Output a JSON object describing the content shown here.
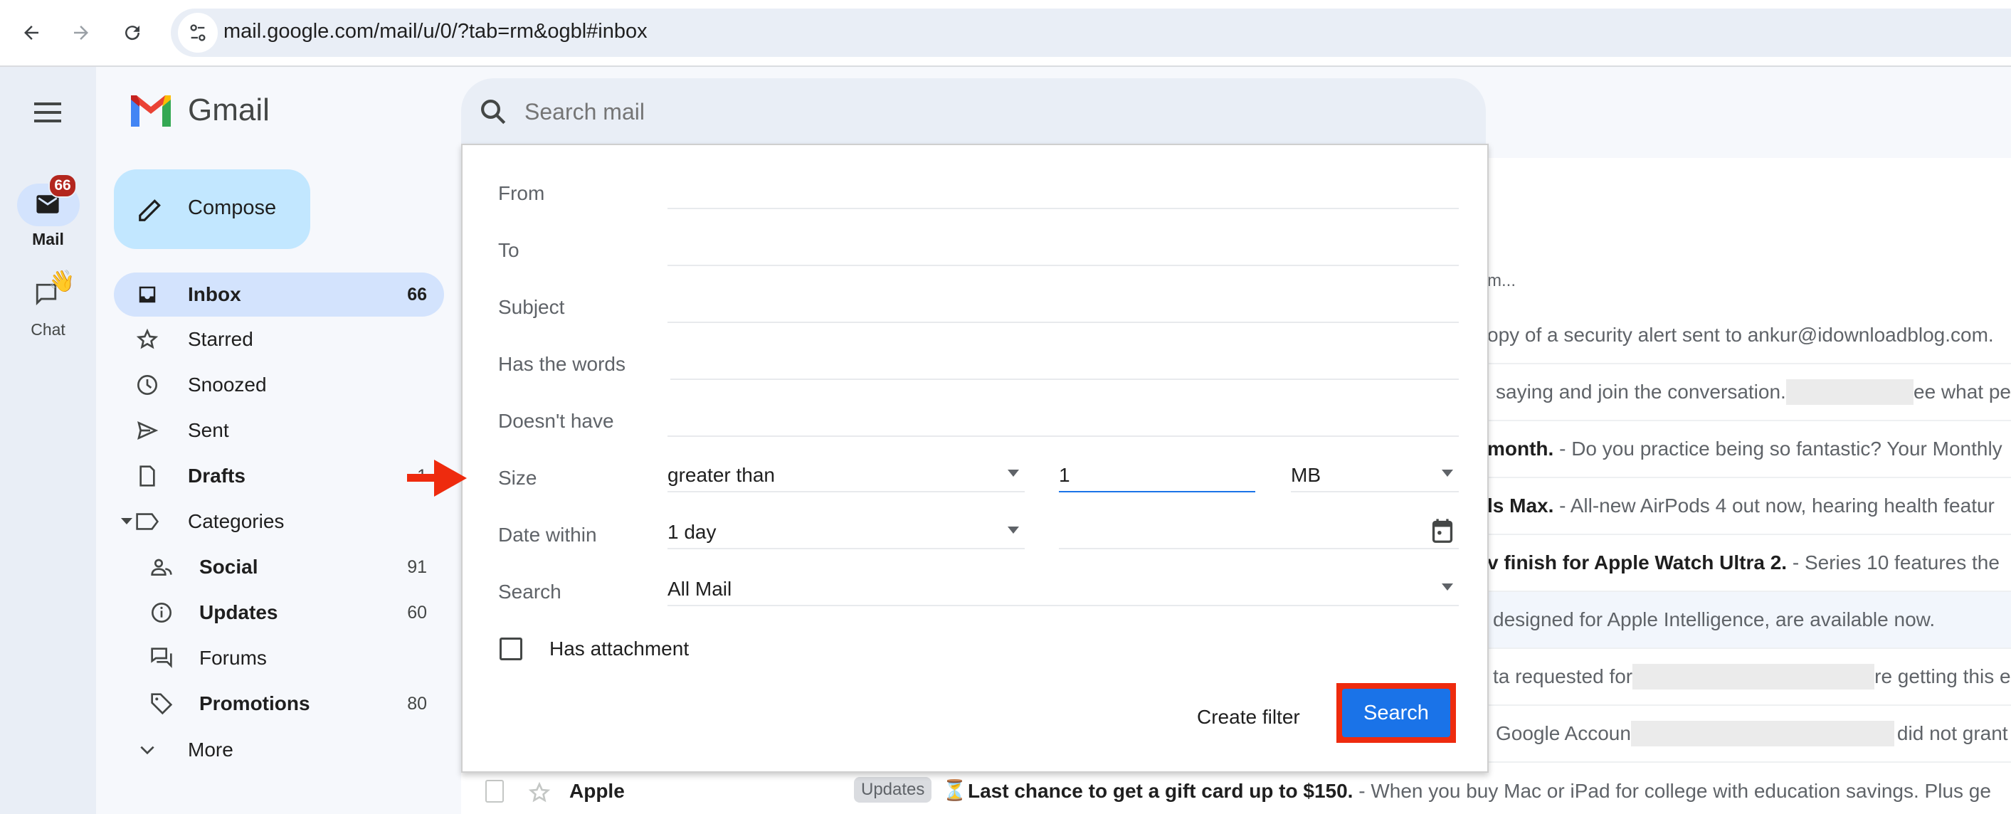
{
  "browser": {
    "url": "mail.google.com/mail/u/0/?tab=rm&ogbl#inbox",
    "back_icon": "arrow-left-icon",
    "forward_icon": "arrow-right-icon",
    "reload_icon": "reload-icon",
    "site_info_icon": "tune-icon"
  },
  "rail": {
    "menu_icon": "hamburger-menu-icon",
    "items": [
      {
        "label": "Mail",
        "icon": "mail-icon",
        "badge": "66"
      },
      {
        "label": "Chat",
        "icon": "chat-icon",
        "badge_icon": "waving-hand-icon"
      }
    ]
  },
  "app": {
    "name": "Gmail",
    "compose_label": "Compose"
  },
  "sidebar": {
    "items": [
      {
        "label": "Inbox",
        "count": "66",
        "icon": "inbox-icon",
        "active": true,
        "bold": true
      },
      {
        "label": "Starred",
        "count": "",
        "icon": "star-icon"
      },
      {
        "label": "Snoozed",
        "count": "",
        "icon": "clock-icon"
      },
      {
        "label": "Sent",
        "count": "",
        "icon": "send-icon"
      },
      {
        "label": "Drafts",
        "count": "1",
        "icon": "draft-icon",
        "bold": true
      },
      {
        "label": "Categories",
        "count": "",
        "icon": "label-icon"
      },
      {
        "label": "Social",
        "count": "91",
        "icon": "people-icon",
        "bold": true
      },
      {
        "label": "Updates",
        "count": "60",
        "icon": "info-icon",
        "bold": true
      },
      {
        "label": "Forums",
        "count": "",
        "icon": "forum-icon"
      },
      {
        "label": "Promotions",
        "count": "80",
        "icon": "tag-icon",
        "bold": true
      },
      {
        "label": "More",
        "count": "",
        "icon": "chevron-down-icon"
      }
    ]
  },
  "search": {
    "placeholder": "Search mail",
    "panel": {
      "from_label": "From",
      "from_value": "",
      "to_label": "To",
      "to_value": "",
      "subject_label": "Subject",
      "subject_value": "",
      "has_words_label": "Has the words",
      "has_words_value": "",
      "doesnt_have_label": "Doesn't have",
      "doesnt_have_value": "",
      "size_label": "Size",
      "size_operator": "greater than",
      "size_value": "1",
      "size_unit": "MB",
      "date_label": "Date within",
      "date_value": "1 day",
      "date_input": "",
      "scope_label": "Search",
      "scope_value": "All Mail",
      "attachment_label": "Has attachment",
      "attachment_checked": false,
      "create_filter_label": "Create filter",
      "search_button_label": "Search"
    }
  },
  "annotations": {
    "arrow_color": "#ee2b0e",
    "highlight_color": "#ee2b0e"
  },
  "email_list": {
    "rows": [
      {
        "snippet_pre": "",
        "bold": "",
        "snippet": "m..."
      },
      {
        "bold": "",
        "snippet": "opy of a security alert sent to ankur@idownloadblog.com."
      },
      {
        "bold": "",
        "snippet": "saying and join the conversation.",
        "redacted": true,
        "snippet_after": "ee what pe"
      },
      {
        "bold": "month.",
        "snippet": " - Do you practice being so fantastic? Your Monthly"
      },
      {
        "bold": "ls Max.",
        "snippet": " - All-new AirPods 4 out now, hearing health featur"
      },
      {
        "bold": "v finish for Apple Watch Ultra 2.",
        "snippet": " - Series 10 features the"
      },
      {
        "bold": "",
        "snippet": "designed for Apple Intelligence, are available now."
      },
      {
        "bold": "",
        "snippet": "ta requested for",
        "redacted": true,
        "snippet_after": "re getting this e"
      },
      {
        "bold": "",
        "snippet": "Google Accoun",
        "redacted": true,
        "snippet_after": "did not grant"
      }
    ],
    "last_row": {
      "sender": "Apple",
      "category": "Updates",
      "emoji": "⏳",
      "subject": "Last chance to get a gift card up to $150.",
      "snippet": " - When you buy Mac or iPad for college with education savings. Plus ge"
    }
  },
  "colors": {
    "primary_blue": "#0b57d0",
    "search_button": "#1a73e8",
    "compose_bg": "#c2e7ff",
    "active_nav": "#d3e3fd",
    "badge_red": "#b3261e"
  }
}
